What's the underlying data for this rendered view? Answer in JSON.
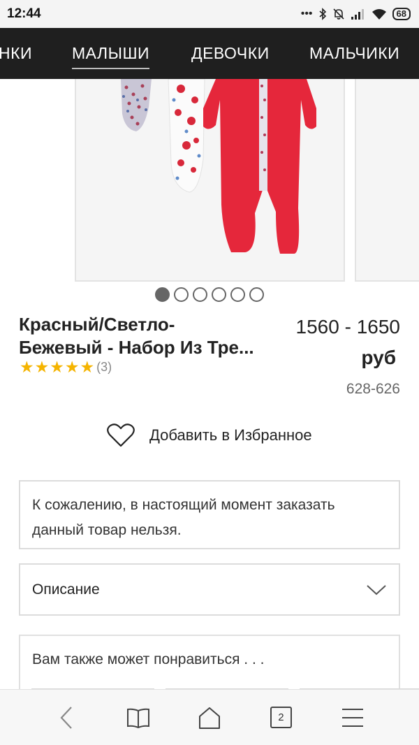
{
  "status_bar": {
    "time": "12:44",
    "icons": [
      "dots-icon",
      "bluetooth-icon",
      "mute-icon",
      "signal-icon",
      "wifi-icon"
    ],
    "battery": "68"
  },
  "category_nav": {
    "items": [
      {
        "label": "НКИ",
        "active": false
      },
      {
        "label": "МАЛЫШИ",
        "active": true
      },
      {
        "label": "ДЕВОЧКИ",
        "active": false
      },
      {
        "label": "МАЛЬЧИКИ",
        "active": false
      }
    ]
  },
  "carousel": {
    "image": "red-floral-baby-sleepsuits-set",
    "dots_total": 6,
    "active_dot": 1
  },
  "product": {
    "title_line1": "Красный/Светло-",
    "title_line2": "Бежевый - Набор Из Тре...",
    "rating": 5,
    "rating_count": "(3)",
    "price_range": "1560 - 1650",
    "currency": "руб",
    "sku": "628-626"
  },
  "wishlist": {
    "label": "Добавить в Избранное",
    "icon": "heart-outline-icon"
  },
  "notice": {
    "text": "К сожалению, в настоящий момент заказать данный товар нельзя."
  },
  "description": {
    "label": "Описание",
    "icon": "chevron-down-icon"
  },
  "recommendations": {
    "title": "Вам также может понравиться . . ."
  },
  "bottom_nav": {
    "items": [
      "back-icon",
      "bookmarks-icon",
      "home-icon",
      "tabs-icon",
      "menu-icon"
    ],
    "tabs_count": "2"
  },
  "colors": {
    "nav_bg": "#1f1f1f",
    "star": "#f5b400",
    "garment_red": "#e5273b"
  }
}
